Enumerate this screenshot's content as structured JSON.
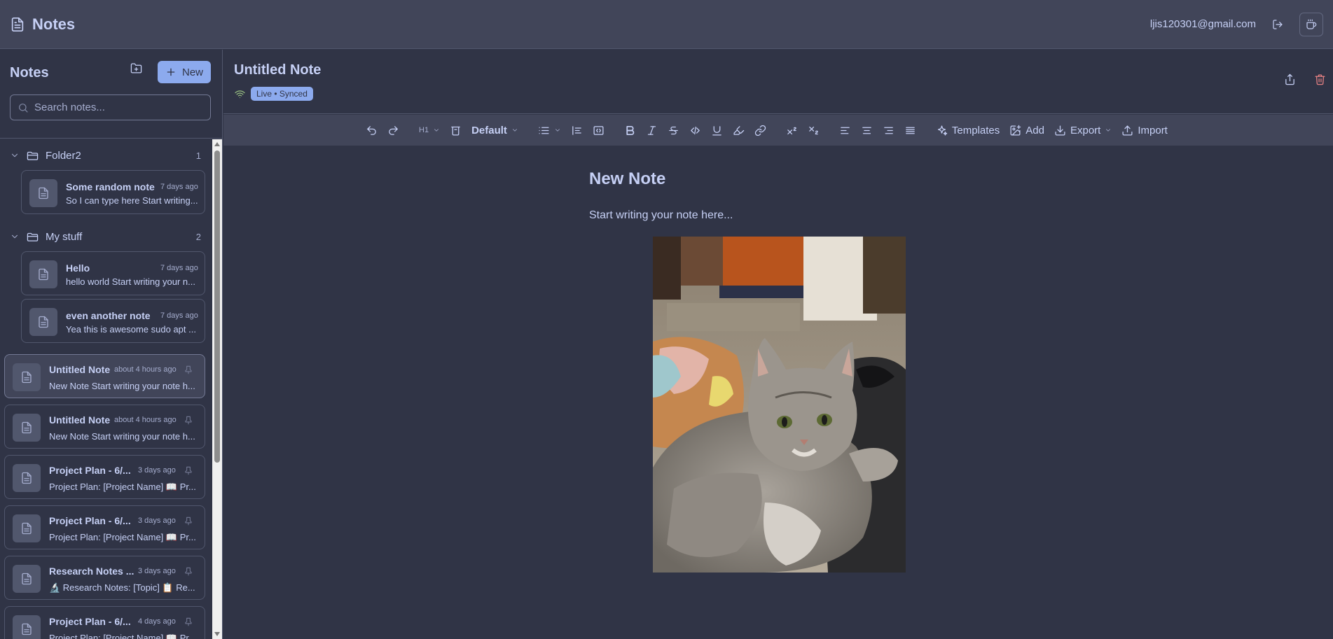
{
  "app": {
    "title": "Notes",
    "user_email": "ljis120301@gmail.com"
  },
  "sidebar": {
    "title": "Notes",
    "new_label": "New",
    "search_placeholder": "Search notes...",
    "folders": [
      {
        "name": "Folder2",
        "count": "1",
        "notes": [
          {
            "title": "Some random note",
            "time": "7 days ago",
            "snippet": "So I can type here Start writing..."
          }
        ]
      },
      {
        "name": "My stuff",
        "count": "2",
        "notes": [
          {
            "title": "Hello",
            "time": "7 days ago",
            "snippet": "hello world Start writing your n..."
          },
          {
            "title": "even another note",
            "time": "7 days ago",
            "snippet": "Yea this is awesome sudo apt ..."
          }
        ]
      }
    ],
    "notes": [
      {
        "title": "Untitled Note",
        "time": "about 4 hours ago",
        "snippet": "New Note Start writing your note h...",
        "active": true
      },
      {
        "title": "Untitled Note",
        "time": "about 4 hours ago",
        "snippet": "New Note Start writing your note h..."
      },
      {
        "title": "Project Plan - 6/...",
        "time": "3 days ago",
        "snippet": "Project Plan: [Project Name] 📖 Pr..."
      },
      {
        "title": "Project Plan - 6/...",
        "time": "3 days ago",
        "snippet": "Project Plan: [Project Name] 📖 Pr..."
      },
      {
        "title": "Research Notes ...",
        "time": "3 days ago",
        "snippet": "🔬 Research Notes: [Topic] 📋 Re..."
      },
      {
        "title": "Project Plan - 6/...",
        "time": "4 days ago",
        "snippet": "Project Plan: [Project Name] 📖 Pr..."
      }
    ]
  },
  "note": {
    "heading": "Untitled Note",
    "sync_status": "Live • Synced"
  },
  "toolbar": {
    "heading_level": "H1",
    "font_family": "Default",
    "templates_label": "Templates",
    "add_label": "Add",
    "export_label": "Export",
    "import_label": "Import"
  },
  "editor": {
    "title": "New Note",
    "body": "Start writing your note here...",
    "image": "photo of a gray tabby cat lying on a blanket"
  },
  "colors": {
    "background": "#303446",
    "surface": "#414559",
    "accent": "#8caaee",
    "text": "#c6d0f5",
    "danger": "#e78284",
    "live": "#a6d189"
  }
}
